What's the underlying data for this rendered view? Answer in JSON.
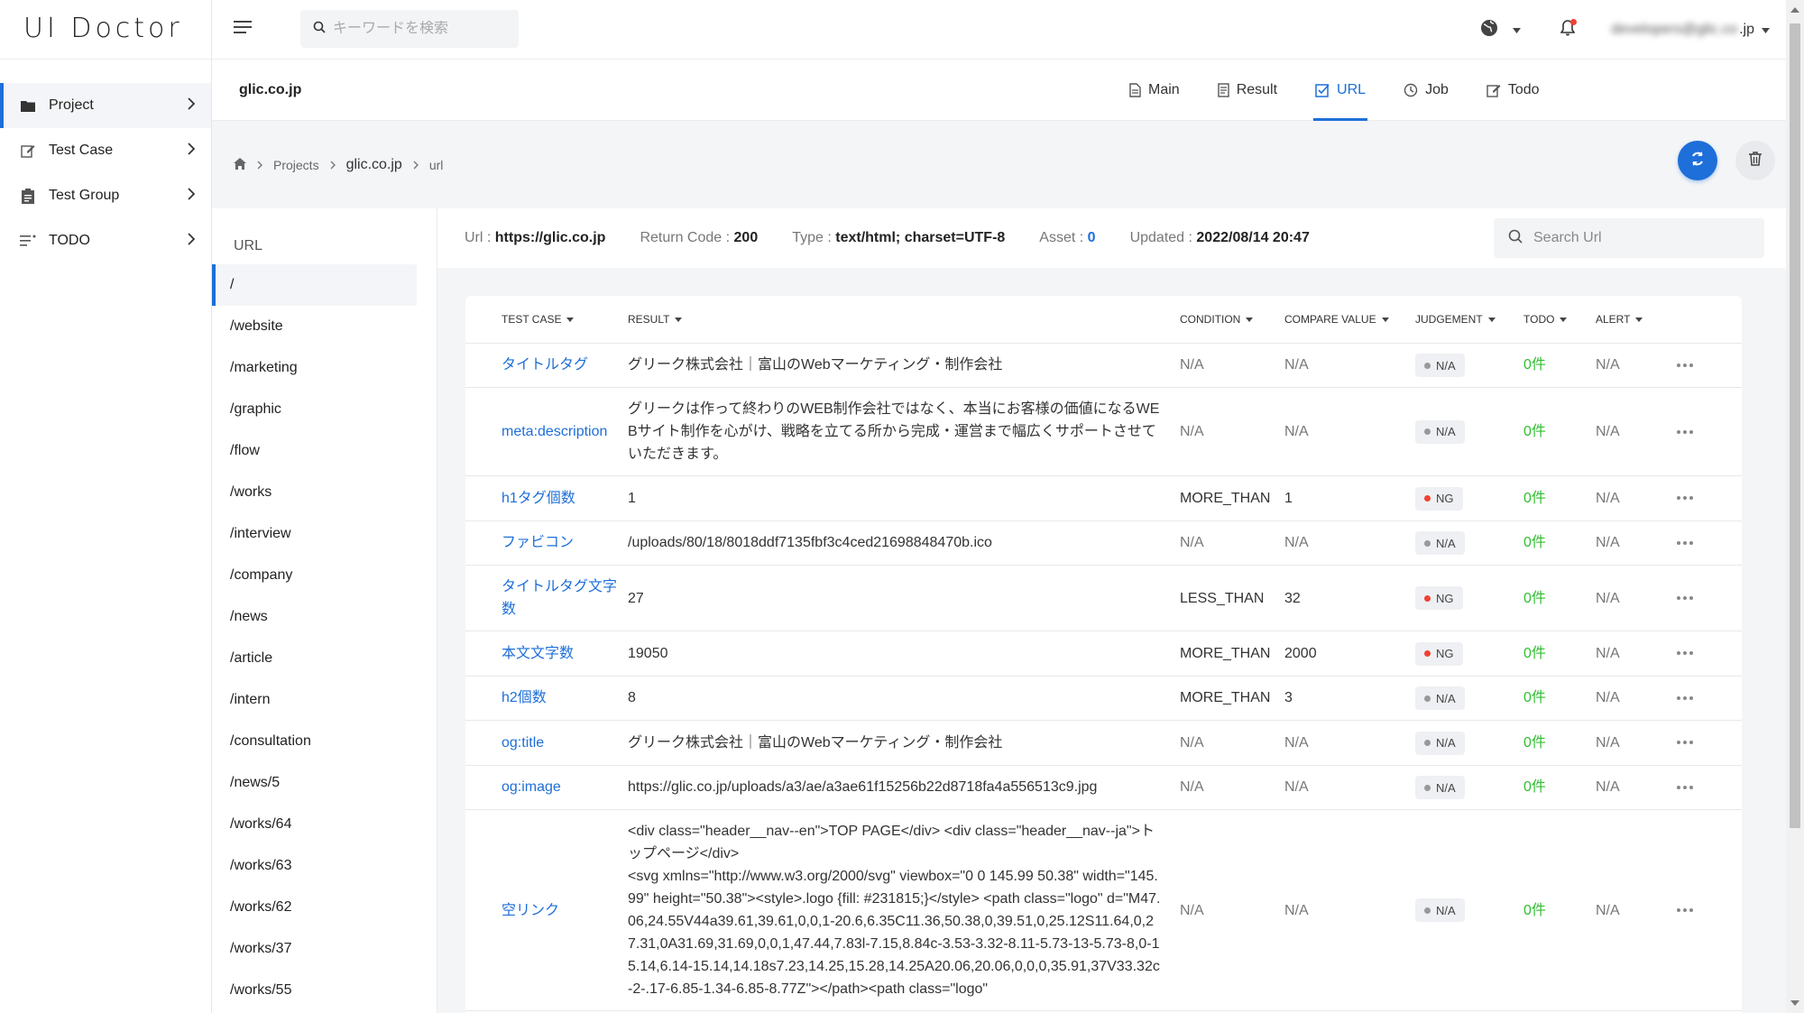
{
  "app": {
    "logo": "UI Doctor"
  },
  "sidebar": {
    "items": [
      {
        "label": "Project",
        "icon": "folder-icon"
      },
      {
        "label": "Test Case",
        "icon": "edit-icon"
      },
      {
        "label": "Test Group",
        "icon": "clipboard-icon"
      },
      {
        "label": "TODO",
        "icon": "list-icon"
      }
    ]
  },
  "header": {
    "search_placeholder": "キーワードを検索",
    "user_email_masked": "developers@glic.co",
    "user_email_suffix": ".jp"
  },
  "subheader": {
    "domain": "glic.co.jp",
    "tabs": [
      {
        "label": "Main"
      },
      {
        "label": "Result"
      },
      {
        "label": "URL"
      },
      {
        "label": "Job"
      },
      {
        "label": "Todo"
      }
    ]
  },
  "breadcrumb": {
    "projects": "Projects",
    "domain": "glic.co.jp",
    "current": "url"
  },
  "url_panel": {
    "heading": "URL",
    "items": [
      "/",
      "/website",
      "/marketing",
      "/graphic",
      "/flow",
      "/works",
      "/interview",
      "/company",
      "/news",
      "/article",
      "/intern",
      "/consultation",
      "/news/5",
      "/works/64",
      "/works/63",
      "/works/62",
      "/works/37",
      "/works/55"
    ]
  },
  "info": {
    "url_label": "Url :",
    "url_value": "https://glic.co.jp",
    "code_label": "Return Code :",
    "code_value": "200",
    "type_label": "Type :",
    "type_value": "text/html; charset=UTF-8",
    "asset_label": "Asset :",
    "asset_value": "0",
    "updated_label": "Updated :",
    "updated_value": "2022/08/14 20:47",
    "search_placeholder": "Search Url"
  },
  "table": {
    "columns": [
      "TEST CASE",
      "RESULT",
      "CONDITION",
      "COMPARE VALUE",
      "JUDGEMENT",
      "TODO",
      "ALERT"
    ],
    "rows": [
      {
        "test_case": "タイトルタグ",
        "result": "グリーク株式会社｜富山のWebマーケティング・制作会社",
        "condition": "N/A",
        "compare": "N/A",
        "judgement": "N/A",
        "todo": "0件",
        "alert": "N/A"
      },
      {
        "test_case": "meta:description",
        "result": "グリークは作って終わりのWEB制作会社ではなく、本当にお客様の価値になるWEBサイト制作を心がけ、戦略を立てる所から完成・運営まで幅広くサポートさせていただきます。",
        "condition": "N/A",
        "compare": "N/A",
        "judgement": "N/A",
        "todo": "0件",
        "alert": "N/A"
      },
      {
        "test_case": "h1タグ個数",
        "result": "1",
        "condition": "MORE_THAN",
        "compare": "1",
        "judgement": "NG",
        "todo": "0件",
        "alert": "N/A"
      },
      {
        "test_case": "ファビコン",
        "result": "/uploads/80/18/8018ddf7135fbf3c4ced21698848470b.ico",
        "condition": "N/A",
        "compare": "N/A",
        "judgement": "N/A",
        "todo": "0件",
        "alert": "N/A"
      },
      {
        "test_case": "タイトルタグ文字数",
        "result": "27",
        "condition": "LESS_THAN",
        "compare": "32",
        "judgement": "NG",
        "todo": "0件",
        "alert": "N/A"
      },
      {
        "test_case": "本文文字数",
        "result": "19050",
        "condition": "MORE_THAN",
        "compare": "2000",
        "judgement": "NG",
        "todo": "0件",
        "alert": "N/A"
      },
      {
        "test_case": "h2個数",
        "result": "8",
        "condition": "MORE_THAN",
        "compare": "3",
        "judgement": "N/A",
        "todo": "0件",
        "alert": "N/A"
      },
      {
        "test_case": "og:title",
        "result": "グリーク株式会社｜富山のWebマーケティング・制作会社",
        "condition": "N/A",
        "compare": "N/A",
        "judgement": "N/A",
        "todo": "0件",
        "alert": "N/A"
      },
      {
        "test_case": "og:image",
        "result": "https://glic.co.jp/uploads/a3/ae/a3ae61f15256b22d8718fa4a556513c9.jpg",
        "condition": "N/A",
        "compare": "N/A",
        "judgement": "N/A",
        "todo": "0件",
        "alert": "N/A"
      },
      {
        "test_case": "空リンク",
        "result": "<div class=\"header__nav--en\">TOP PAGE</div> <div class=\"header__nav--ja\">トップページ</div>\n<svg xmlns=\"http://www.w3.org/2000/svg\" viewbox=\"0 0 145.99 50.38\" width=\"145.99\" height=\"50.38\"><style>.logo {fill: #231815;}</style> <path class=\"logo\" d=\"M47.06,24.55V44a39.61,39.61,0,0,1-20.6,6.35C11.36,50.38,0,39.51,0,25.12S11.64,0,27.31,0A31.69,31.69,0,0,1,47.44,7.83l-7.15,8.84c-3.53-3.32-8.11-5.73-13-5.73-8,0-15.14,6.14-15.14,14.18s7.23,14.25,15.28,14.25A20.06,20.06,0,0,0,35.91,37V33.32c-2-.17-6.85-1.34-6.85-8.77Z\"></path><path class=\"logo\"",
        "condition": "N/A",
        "compare": "N/A",
        "judgement": "N/A",
        "todo": "0件",
        "alert": "N/A"
      }
    ]
  },
  "colors": {
    "accent": "#1e6fd9",
    "ng": "#f04134",
    "todo": "#2fbf2f"
  }
}
